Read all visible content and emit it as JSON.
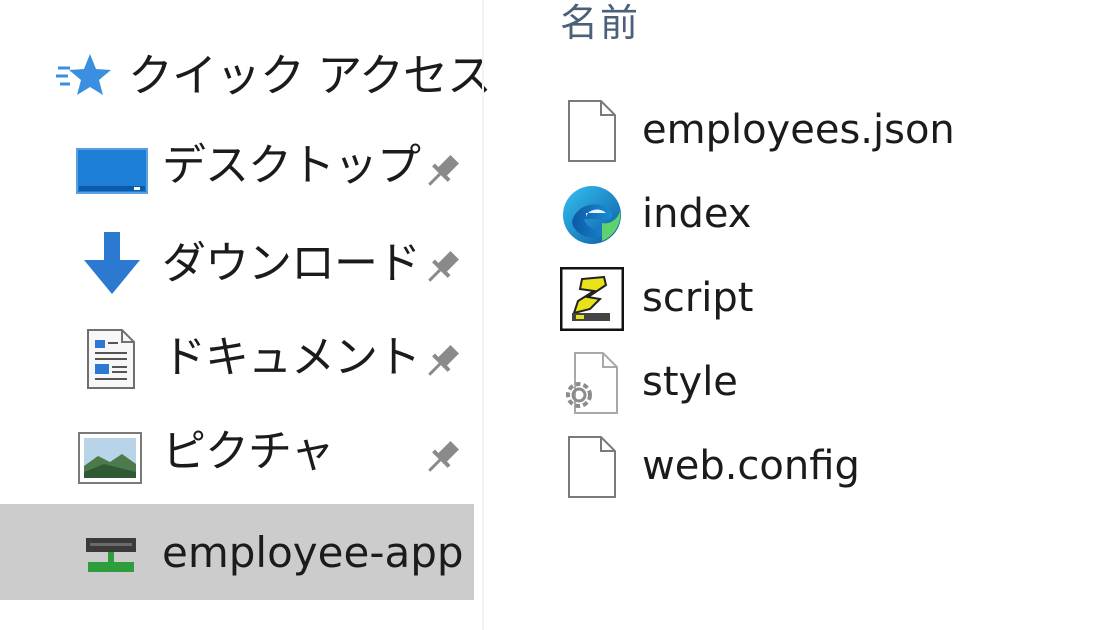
{
  "navigation": {
    "quick_access": {
      "label": "クイック アクセス",
      "icon": "star-icon"
    },
    "items": [
      {
        "label": "デスクトップ",
        "icon": "desktop-icon",
        "pinned": true
      },
      {
        "label": "ダウンロード",
        "icon": "download-icon",
        "pinned": true
      },
      {
        "label": "ドキュメント",
        "icon": "document-icon",
        "pinned": true
      },
      {
        "label": "ピクチャ",
        "icon": "pictures-icon",
        "pinned": true
      },
      {
        "label": "employee-app",
        "icon": "network-folder-icon",
        "pinned": false,
        "selected": true
      }
    ]
  },
  "content": {
    "column_header": "名前",
    "files": [
      {
        "name": "employees.json",
        "icon": "blank-file-icon"
      },
      {
        "name": "index",
        "icon": "edge-html-icon"
      },
      {
        "name": "script",
        "icon": "js-script-icon"
      },
      {
        "name": "style",
        "icon": "css-gear-file-icon"
      },
      {
        "name": "web.config",
        "icon": "blank-file-icon"
      }
    ]
  },
  "colors": {
    "selected_background": "#cccccc",
    "column_header": "#4c607a",
    "star_blue": "#3b8fe0",
    "desktop_blue": "#1e7fd6",
    "download_blue": "#2b79d0",
    "pin_gray": "#8a8a8a"
  }
}
